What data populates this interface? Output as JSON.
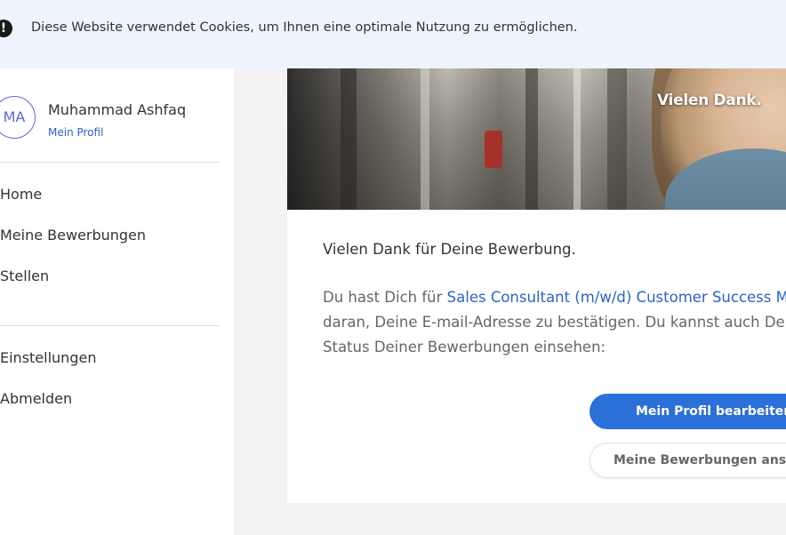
{
  "cookie_banner": {
    "icon": "exclamation-icon",
    "text": "Diese Website verwendet Cookies, um Ihnen eine optimale Nutzung zu ermöglichen."
  },
  "sidebar": {
    "avatar_initials": "MA",
    "user_name": "Muhammad Ashfaq",
    "profile_link": "Mein Profil",
    "nav_primary": [
      "Home",
      "Meine Bewerbungen",
      "Stellen"
    ],
    "nav_secondary": [
      "Einstellungen",
      "Abmelden"
    ]
  },
  "hero": {
    "title": "Vielen Dank."
  },
  "card": {
    "heading": "Vielen Dank für Deine Bewerbung.",
    "body_prefix": "Du hast Dich für ",
    "job_link": "Sales Consultant (m/w/d) Customer Success M",
    "line2": "daran, Deine E-mail-Adresse zu bestätigen. Du kannst auch De",
    "line3": "Status Deiner Bewerbungen einsehen:",
    "primary_button": "Mein Profil bearbeiten",
    "secondary_button": "Meine Bewerbungen ansehe"
  },
  "colors": {
    "accent": "#2b6fd8",
    "link": "#2b63c8",
    "banner_bg": "#eef4fb",
    "page_bg": "#f3f3f3"
  }
}
